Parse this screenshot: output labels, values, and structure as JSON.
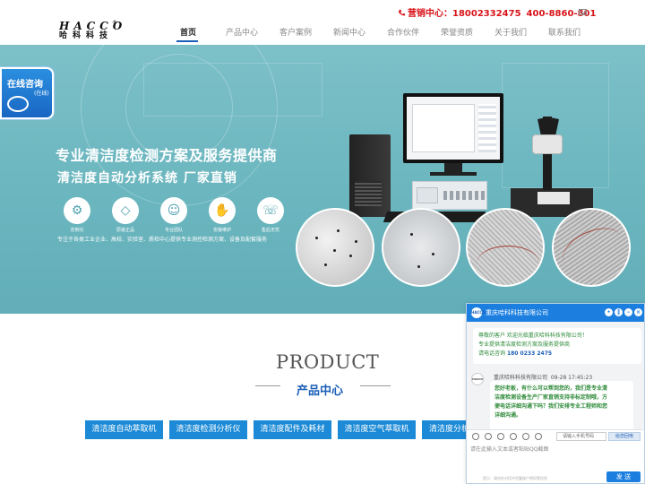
{
  "brand": {
    "logo_mark": "HACCO",
    "logo_cn": "哈科科技",
    "logo_reg": "®",
    "hotline_label": "营销中心：",
    "hotline_mobile": "18002332475",
    "hotline_tel": "400-8860-801"
  },
  "nav": {
    "items": [
      "首页",
      "产品中心",
      "客户案例",
      "新闻中心",
      "合作伙伴",
      "荣誉资质",
      "关于我们",
      "联系我们"
    ],
    "active_index": 0
  },
  "consult_badge": {
    "title": "在线咨询",
    "sub": "(在线)"
  },
  "banner": {
    "headline": "专业清洁度检测方案及服务提供商",
    "subheadline": "清洁度自动分析系统 厂家直销",
    "features": [
      {
        "label": "定制化",
        "icon": "gear-icon"
      },
      {
        "label": "原装正品",
        "icon": "diamond-icon"
      },
      {
        "label": "专业团队",
        "icon": "team-icon"
      },
      {
        "label": "安装维护",
        "icon": "handshake-icon"
      },
      {
        "label": "售后无忧",
        "icon": "service-icon"
      }
    ],
    "tagline": "专注于各类工业企业、高校、实验室、质检中心提供专业测控检测方案、设备及配套服务",
    "slides_total": 3,
    "slide_active_index": 1
  },
  "product_section": {
    "title_en": "PRODUCT",
    "title_cn": "产品中心",
    "categories": [
      "清洁度自动萃取机",
      "清洁度检测分析仪",
      "清洁度配件及耗材",
      "清洁度空气萃取机",
      "清洁度分析"
    ]
  },
  "chat": {
    "company": "重庆哈科科技有限公司",
    "welcome_lines": [
      "尊敬的客户 欢迎光临重庆哈科科技有限公司！",
      "专业提供清洁度检测方案及服务提供商",
      "请电话咨询"
    ],
    "welcome_phone": "180 0233 2475",
    "sender": "重庆哈科科技有限公司",
    "time": "09-28 17:45:23",
    "message_lines": [
      "您好老板，有什么可以帮到您的，我们是专业清",
      "洁度检测设备生产厂家直销支持非标定制哦，方",
      "便电话详细沟通下吗？我们安排专业工程师和您",
      "详细沟通。"
    ],
    "phone_placeholder": "请输入手机号码",
    "consult_button": "给您回电",
    "input_placeholder": "请在此输入文本或者粘贴QQ截图",
    "footer_hint": "提示：请勿在对话中泄露账户密码等信息",
    "send_button": "发 送"
  }
}
